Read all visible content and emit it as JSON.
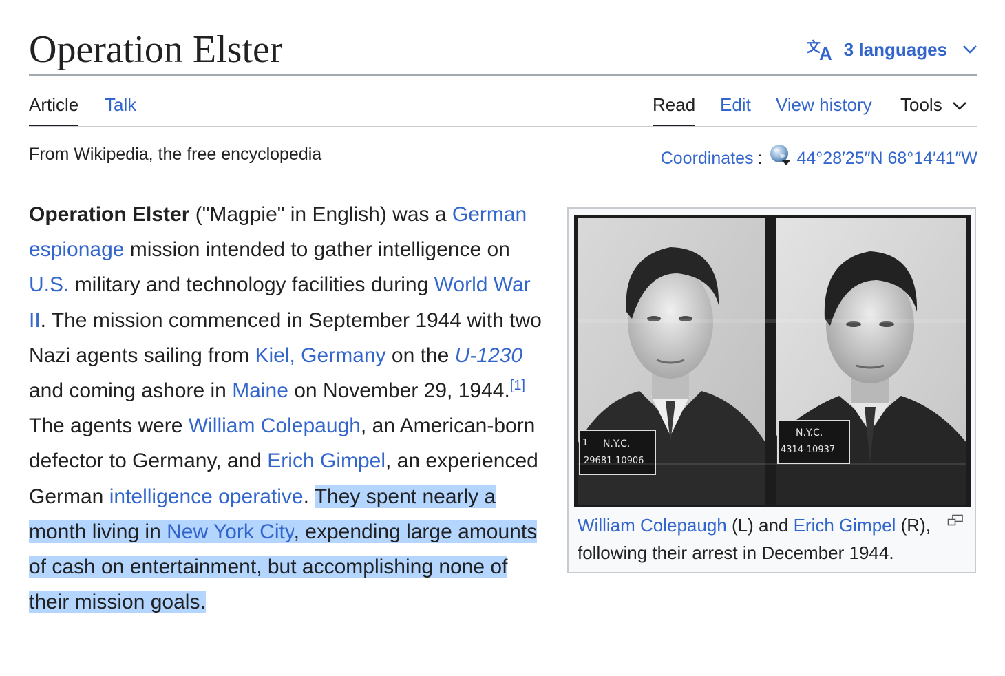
{
  "title": "Operation Elster",
  "languages": {
    "label": "3 languages"
  },
  "tabs": {
    "article": "Article",
    "talk": "Talk",
    "read": "Read",
    "edit": "Edit",
    "history": "View history",
    "tools": "Tools"
  },
  "tagline": "From Wikipedia, the free encyclopedia",
  "coordinates": {
    "label": "Coordinates",
    "colon": ":",
    "value": "44°28′25″N 68°14′41″W"
  },
  "lead": {
    "t1": "Operation Elster",
    "t2": " (\"Magpie\" in English) was a ",
    "l1": "German espionage",
    "t3": " mission intended to gather intelligence on ",
    "l2": "U.S.",
    "t4": " military and technology facilities during ",
    "l3": "World War II",
    "t5": ". The mission commenced in September 1944 with two Nazi agents sailing from ",
    "l4": "Kiel, Germany",
    "t6": " on the ",
    "l5": "U-1230",
    "t7": " and coming ashore in ",
    "l6": "Maine",
    "t8": " on November 29, 1944.",
    "ref": "[1]",
    "t9": " The agents were ",
    "l7": "William Colepaugh",
    "t10": ", an American-born defector to Germany, and ",
    "l8": "Erich Gimpel",
    "t11": ", an experienced German ",
    "l9": "intelligence operative",
    "t12": ". ",
    "s1": "They spent nearly a month living in ",
    "s2": "New York City",
    "s3": ", expending large amounts of cash on entertainment, but accomplishing none of their mission goals."
  },
  "figure": {
    "caption_link1": "William Colepaugh",
    "caption_t1": " (L) and ",
    "caption_link2": "Erich Gimpel",
    "caption_t2": " (R), following their arrest in December 1944.",
    "left_sign_line1": "N.Y.C.",
    "left_sign_line2": "29681-10906",
    "left_sign_corner": "1",
    "right_sign_line1": "N.Y.C.",
    "right_sign_line2": "4314-10937"
  },
  "colors": {
    "link": "#3366cc",
    "text": "#202122",
    "selection": "#b4d5fe",
    "rule": "#a2a9b1"
  }
}
